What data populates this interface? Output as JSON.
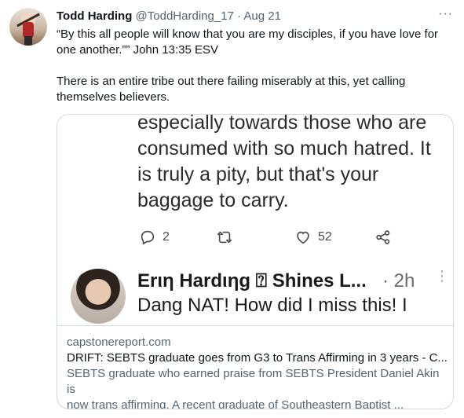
{
  "tweet": {
    "author_name": "Todd Harding",
    "author_handle": "@ToddHarding_17",
    "separator": "·",
    "date": "Aug 21",
    "more_label": "···",
    "text_line1": "“By this all people will know that you are my disciples, if you have love for",
    "text_line2": "one another.”” John 13:35 ESV",
    "text_line3": "There is an entire tribe out there failing miserably at this, yet calling",
    "text_line4": "themselves believers."
  },
  "card": {
    "screenshot": {
      "lines": [
        "especially towards those who are",
        "consumed with so much hatred. It",
        "is truly a pity, but that's your",
        "baggage to carry."
      ],
      "actions": {
        "reply_count": "2",
        "retweet_count": "",
        "like_count": "52"
      },
      "reply": {
        "name": "Erιη Hardιηg ⍰ Shines L...",
        "time": "· 2h",
        "more": "⋮",
        "text": "Dang NAT! How did I miss this! I"
      }
    },
    "domain": "capstonereport.com",
    "title": "DRIFT: SEBTS graduate goes from G3 to Trans Affirming in 3 years - C...",
    "description_line1": "SEBTS graduate who earned praise from SEBTS President Daniel Akin is",
    "description_line2": "now trans affirming. A recent graduate of Southeastern Baptist ..."
  },
  "icons": {
    "reply": "reply-icon",
    "retweet": "retweet-icon",
    "like": "heart-icon",
    "share": "share-icon"
  },
  "colors": {
    "text": "#0f1419",
    "secondary": "#536471",
    "border": "#cfd9de"
  }
}
